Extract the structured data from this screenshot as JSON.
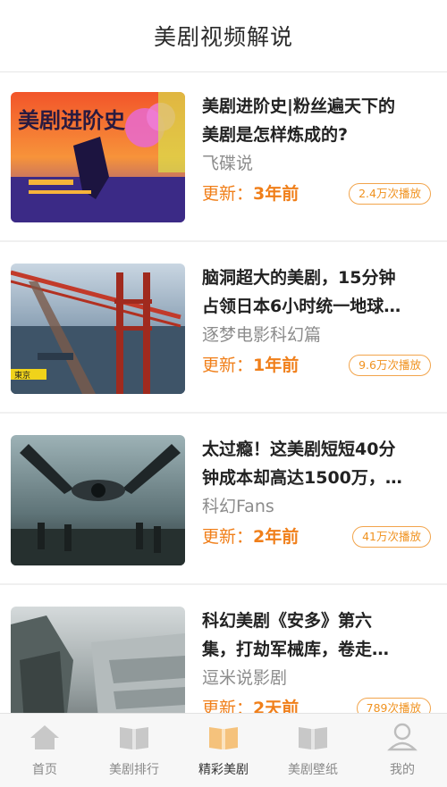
{
  "header": {
    "title": "美剧视频解说"
  },
  "videos": [
    {
      "title_line1": "美剧进阶史|粉丝遍天下的",
      "title_line2": "美剧是怎样炼成的?",
      "source": "飞碟说",
      "update_prefix": "更新：",
      "update_value": "3年前",
      "plays": "2.4万次播放",
      "thumb_text": "美剧进阶史"
    },
    {
      "title_line1": "脑洞超大的美剧，15分钟",
      "title_line2": "占领日本6小时统一地球…",
      "source": "逐梦电影科幻篇",
      "update_prefix": "更新：",
      "update_value": "1年前",
      "plays": "9.6万次播放",
      "thumb_text": "東京"
    },
    {
      "title_line1": "太过瘾！这美剧短短40分",
      "title_line2": "钟成本却高达1500万，…",
      "source": "科幻Fans",
      "update_prefix": "更新：",
      "update_value": "2年前",
      "plays": "41万次播放"
    },
    {
      "title_line1": "科幻美剧《安多》第六",
      "title_line2": "集，打劫军械库，卷走…",
      "source": "逗米说影剧",
      "update_prefix": "更新：",
      "update_value": "2天前",
      "plays": "789次播放"
    }
  ],
  "tabbar": {
    "tabs": [
      {
        "label": "首页",
        "icon": "home-icon"
      },
      {
        "label": "美剧排行",
        "icon": "book-icon"
      },
      {
        "label": "精彩美剧",
        "icon": "book-icon",
        "active": true
      },
      {
        "label": "美剧壁纸",
        "icon": "book-icon"
      },
      {
        "label": "我的",
        "icon": "user-icon"
      }
    ],
    "active_color": "#f5c27c",
    "inactive_color": "#c8c8c8"
  },
  "colors": {
    "accent": "#f07f1a"
  }
}
